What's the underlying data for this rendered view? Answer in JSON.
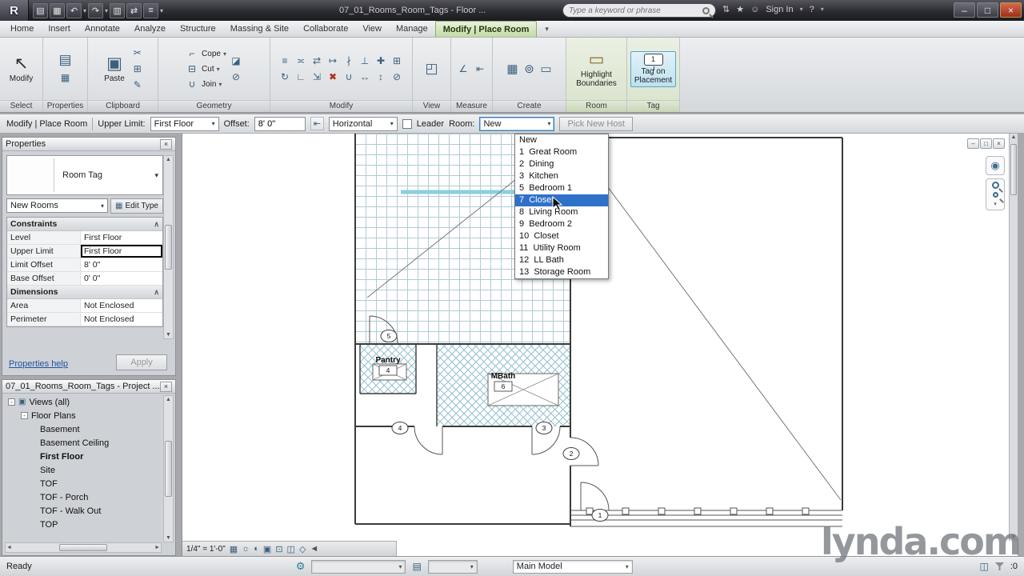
{
  "window": {
    "app_initial": "R",
    "title": "07_01_Rooms_Room_Tags - Floor ...",
    "search_placeholder": "Type a keyword or phrase",
    "sign_in_label": "Sign In"
  },
  "icons": {
    "open": "▤",
    "save": "▦",
    "print": "▥",
    "undo": "↶",
    "redo": "↷",
    "switch_windows": "⇄",
    "worksets": "≡",
    "caret": "▾",
    "comm": "⇅",
    "star": "★",
    "user": "☺",
    "help": "?",
    "minimize": "–",
    "maximize": "□",
    "close": "×",
    "modify_arrow": "↖",
    "properties": "▤",
    "properties2": "▦",
    "paste": "▣",
    "cut_small": "✂",
    "copy_small": "⊞",
    "match": "✎",
    "cope": "⌐",
    "cut_geo": "⊟",
    "join_geo": "∪",
    "paint": "◪",
    "demolish": "⊘",
    "modify_tools": [
      "≡",
      "≍",
      "⇄",
      "↦",
      "∤",
      "⊥",
      "✚",
      "⊞",
      "↻",
      "∟",
      "⇲",
      "✖",
      "∪",
      "↔",
      "↕",
      "⊘"
    ],
    "view_tool": "◰",
    "measure1": "∠",
    "measure2": "⇤",
    "create1": "▦",
    "create2": "⊚",
    "create3": "▭",
    "room_tool": "▭",
    "tag_number": "1",
    "offset_icon": "⇤",
    "section_chevron": "∧",
    "expander_minus": "-",
    "views_icon": "▣",
    "scroll_up": "▲",
    "scroll_down": "▼",
    "scroll_left": "◄",
    "scroll_right": "►",
    "wheel": "◉",
    "vc_icons": [
      "▦",
      "☼",
      "◐",
      "▣",
      "⊡",
      "◫",
      "◇"
    ],
    "gear": "⚙",
    "doc": "▤",
    "excl": "◫"
  },
  "ribbon": {
    "tabs": [
      "Home",
      "Insert",
      "Annotate",
      "Analyze",
      "Structure",
      "Massing & Site",
      "Collaborate",
      "View",
      "Manage"
    ],
    "active_tab": "Modify | Place Room",
    "panels": {
      "select": {
        "label": "Select",
        "modify_button": "Modify"
      },
      "properties": {
        "label": "Properties"
      },
      "clipboard": {
        "label": "Clipboard",
        "paste_button": "Paste"
      },
      "geometry": {
        "label": "Geometry",
        "cope": "Cope",
        "cut": "Cut",
        "join": "Join"
      },
      "modify": {
        "label": "Modify"
      },
      "view": {
        "label": "View"
      },
      "measure": {
        "label": "Measure"
      },
      "create": {
        "label": "Create"
      },
      "room": {
        "label": "Room",
        "button": "Highlight Boundaries"
      },
      "tag": {
        "label": "Tag",
        "button": "Tag on Placement"
      }
    }
  },
  "options_bar": {
    "context_label": "Modify | Place Room",
    "upper_limit_label": "Upper Limit:",
    "upper_limit_value": "First Floor",
    "offset_label": "Offset:",
    "offset_value": "8' 0\"",
    "orientation_value": "Horizontal",
    "leader_label": "Leader",
    "room_label": "Room:",
    "room_value": "New",
    "pick_new_host_label": "Pick New Host"
  },
  "room_dropdown": {
    "items": [
      "New",
      "1  Great Room",
      "2  Dining",
      "3  Kitchen",
      "5  Bedroom 1",
      "7  Closet",
      "8  Living Room",
      "9  Bedroom 2",
      "10  Closet",
      "11  Utility Room",
      "12  LL Bath",
      "13  Storage Room"
    ]
  },
  "properties_palette": {
    "title": "Properties",
    "type_name": "Room Tag",
    "instance_selector": "New Rooms",
    "edit_type_label": "Edit Type",
    "sections": {
      "constraints": {
        "title": "Constraints",
        "rows": [
          {
            "label": "Level",
            "value": "First Floor"
          },
          {
            "label": "Upper Limit",
            "value": "First Floor"
          },
          {
            "label": "Limit Offset",
            "value": "8' 0\""
          },
          {
            "label": "Base Offset",
            "value": "0' 0\""
          }
        ]
      },
      "dimensions": {
        "title": "Dimensions",
        "rows": [
          {
            "label": "Area",
            "value": "Not Enclosed"
          },
          {
            "label": "Perimeter",
            "value": "Not Enclosed"
          }
        ]
      }
    },
    "help_link": "Properties help",
    "apply_label": "Apply"
  },
  "project_browser": {
    "title": "07_01_Rooms_Room_Tags - Project ...",
    "views_root": "Views (all)",
    "floor_plans_group": "Floor Plans",
    "items": [
      "Basement",
      "Basement Ceiling",
      "First Floor",
      "Site",
      "TOF",
      "TOF - Porch",
      "TOF - Walk Out",
      "TOP"
    ]
  },
  "plan": {
    "pantry_label": "Pantry",
    "pantry_number": "4",
    "mbath_label": "MBath",
    "mbath_number": "6",
    "door_tags": [
      "1",
      "2",
      "3",
      "4",
      "5"
    ]
  },
  "view_bar": {
    "scale": "1/4\" = 1'-0\""
  },
  "status_bar": {
    "ready": "Ready",
    "main_model": "Main Model",
    "filter_count": ":0"
  },
  "watermark": "lynda.com"
}
